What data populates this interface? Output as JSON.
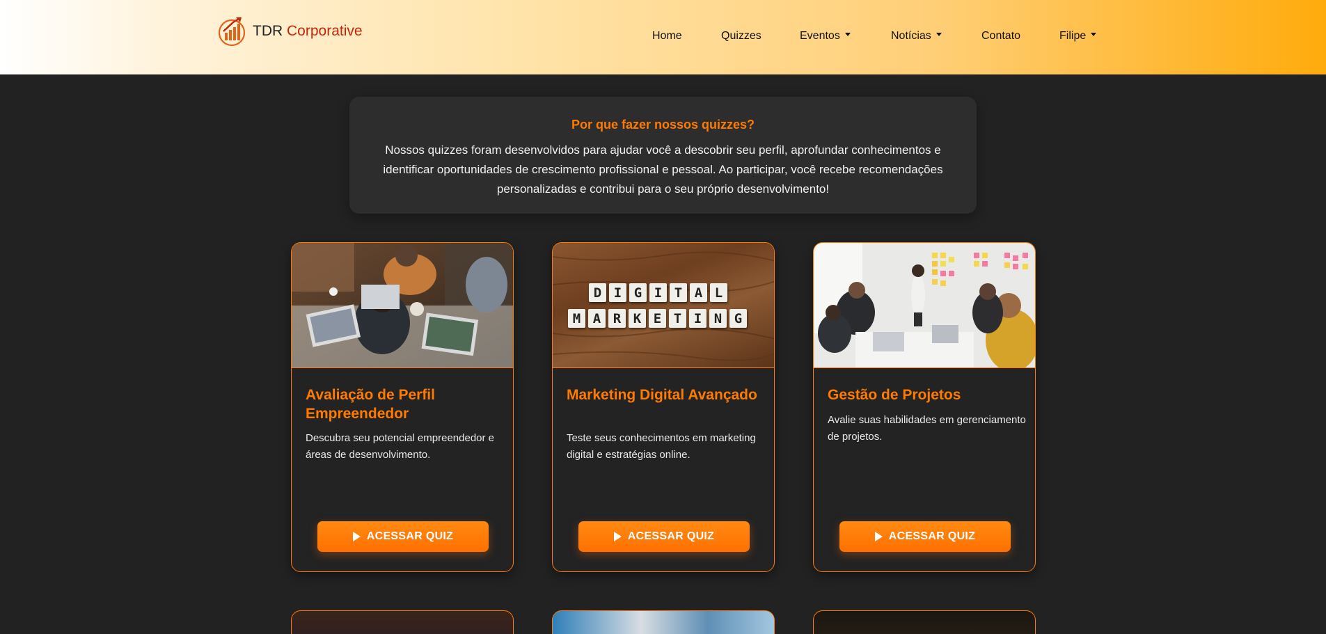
{
  "brand": {
    "name": "TDR",
    "accent": "Corporative",
    "logo_icon": "growth-chart-logo"
  },
  "nav": {
    "home": "Home",
    "quizzes": "Quizzes",
    "eventos": "Eventos",
    "noticias": "Notícias",
    "contato": "Contato",
    "user": "Filipe"
  },
  "intro": {
    "title": "Por que fazer nossos quizzes?",
    "text": "Nossos quizzes foram desenvolvidos para ajudar você a descobrir seu perfil, aprofundar conhecimentos e identificar oportunidades de crescimento profissional e pessoal. Ao participar, você recebe recomendações personalizadas e contribui para o seu próprio desenvolvimento!"
  },
  "cards": [
    {
      "title": "Avaliação de Perfil Empreendedor",
      "desc": "Descubra seu potencial empreendedor e áreas de desenvolvimento.",
      "button": "ACESSAR QUIZ",
      "image": "team-working-laptops-photo"
    },
    {
      "title": "Marketing Digital Avançado",
      "desc": "Teste seus conhecimentos em marketing digital e estratégias online.",
      "button": "ACESSAR QUIZ",
      "image": "scrabble-tiles-photo",
      "image_text_1": "DIGITAL",
      "image_text_2": "MARKETING"
    },
    {
      "title": "Gestão de Projetos",
      "desc": "Avalie suas habilidades em gerenciamento de projetos.",
      "button": "ACESSAR QUIZ",
      "image": "meeting-sticky-notes-photo"
    }
  ],
  "colors": {
    "accent": "#ff7a00",
    "background": "#222222",
    "card": "#232323"
  }
}
